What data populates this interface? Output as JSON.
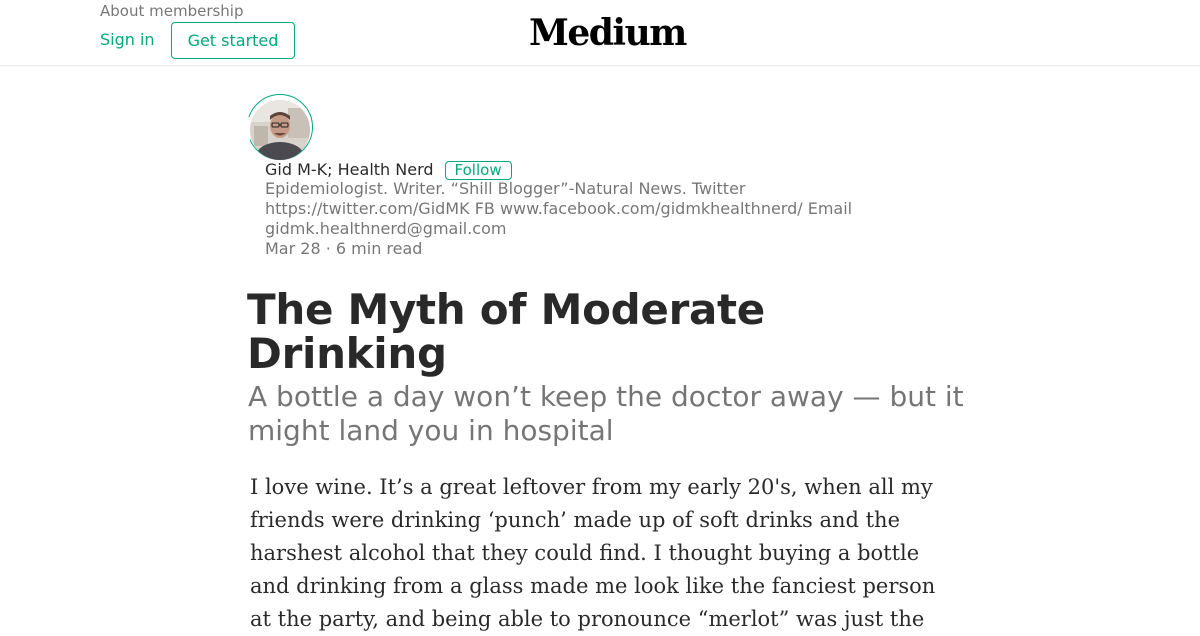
{
  "header": {
    "about_label": "About membership",
    "sign_in_label": "Sign in",
    "get_started_label": "Get started",
    "logo_text": "Medium"
  },
  "author": {
    "name": "Gid M-K; Health Nerd",
    "follow_label": "Follow",
    "bio": "Epidemiologist. Writer. “Shill Blogger”-Natural News. Twitter https://twitter.com/GidMK FB www.facebook.com/gidmkhealthnerd/ Email gidmk.healthnerd@gmail.com",
    "avatar_icon": "user-avatar-photo"
  },
  "meta": {
    "text": "Mar 28 · 6 min read"
  },
  "article": {
    "title": "The Myth of Moderate Drinking",
    "subtitle": "A bottle a day won’t keep the doctor away — but it might land you in hospital",
    "paragraph_1": "I love wine. It’s a great leftover from my early 20's, when all my friends were drinking ‘punch’ made up of soft drinks and the harshest alcohol that they could find. I thought buying a bottle and drinking from a glass made me look like the fanciest person at the party, and being able to pronounce “merlot” was just the"
  },
  "colors": {
    "accent": "#03a87c",
    "text": "rgba(0,0,0,0.84)",
    "muted": "rgba(0,0,0,0.54)"
  }
}
